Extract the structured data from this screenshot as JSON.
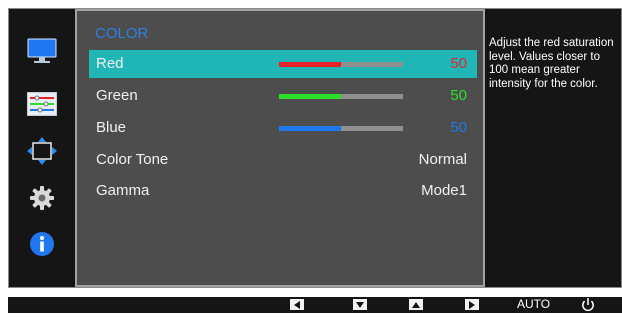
{
  "menu": {
    "title": "COLOR",
    "items": [
      {
        "label": "Red",
        "value": "50",
        "level": 0.5,
        "color": "#e8202a",
        "selected": true
      },
      {
        "label": "Green",
        "value": "50",
        "level": 0.5,
        "color": "#2ae02a",
        "selected": false
      },
      {
        "label": "Blue",
        "value": "50",
        "level": 0.5,
        "color": "#1f78f0",
        "selected": false
      },
      {
        "label": "Color Tone",
        "value": "Normal"
      },
      {
        "label": "Gamma",
        "value": "Mode1"
      }
    ]
  },
  "rail": {
    "icons": [
      "monitor-icon",
      "sliders-icon",
      "resize-arrows-icon",
      "gear-icon",
      "info-icon"
    ]
  },
  "help": {
    "text": "Adjust the red saturation level. Values closer to 100 mean greater intensity for the color."
  },
  "bottom_bar": {
    "buttons": [
      "left-arrow-icon",
      "down-arrow-icon",
      "up-arrow-icon",
      "right-arrow-icon"
    ],
    "auto_label": "AUTO",
    "power_icon": "power-icon"
  },
  "colors": {
    "accent": "#2d7fe0",
    "selection": "#20b6b6",
    "panel": "#4d4d4d"
  }
}
